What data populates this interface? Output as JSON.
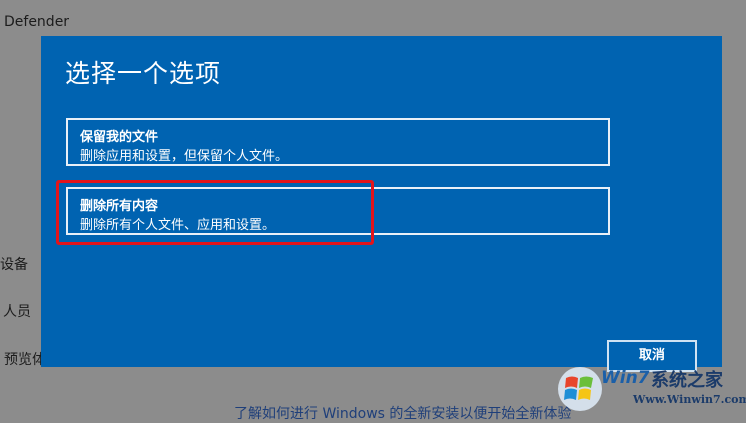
{
  "background": {
    "defender_label": "Defender",
    "devices_label": "设备",
    "people_label": "人员",
    "preview_label": "预览体",
    "bottom_link": "了解如何进行 Windows 的全新安装以便开始全新体验"
  },
  "dialog": {
    "title": "选择一个选项",
    "options": [
      {
        "title": "保留我的文件",
        "desc": "删除应用和设置，但保留个人文件。"
      },
      {
        "title": "删除所有内容",
        "desc": "删除所有个人文件、应用和设置。"
      }
    ],
    "cancel_label": "取消",
    "accent_color": "#0063b1",
    "highlight_color": "#e3141b"
  },
  "watermark": {
    "brand_latin": "Win7",
    "brand_cn": "系统之家",
    "url": "Www.Winwin7.com"
  }
}
